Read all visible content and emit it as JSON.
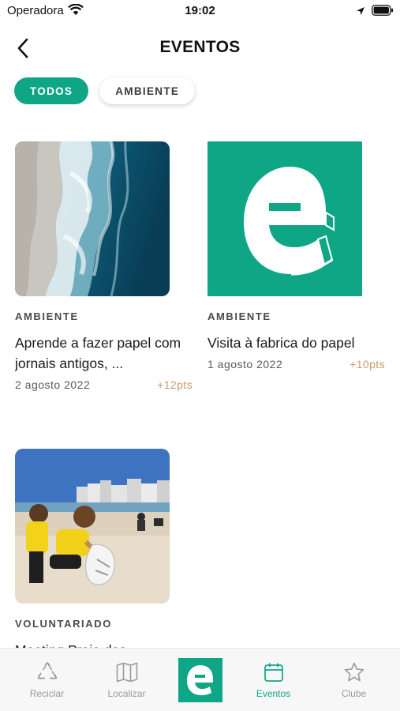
{
  "status_bar": {
    "carrier": "Operadora",
    "time": "19:02"
  },
  "nav": {
    "title": "EVENTOS"
  },
  "filters": [
    {
      "label": "TODOS",
      "active": true
    },
    {
      "label": "AMBIENTE",
      "active": false
    }
  ],
  "events": [
    {
      "category": "AMBIENTE",
      "title": "Aprende a fazer papel com jornais antigos, ...",
      "date": "2 agosto 2022",
      "points": "+12pts",
      "image": "ocean-waves-photo"
    },
    {
      "category": "AMBIENTE",
      "title": "Visita à fabrica do papel",
      "date": "1 agosto 2022",
      "points": "+10pts",
      "image": "brand-logo-e"
    },
    {
      "category": "VOLUNTARIADO",
      "title": "Meeting Praia dos ...",
      "image": "beach-cleanup-photo"
    }
  ],
  "tab_bar": {
    "items": [
      {
        "label": "Reciclar",
        "icon": "recycle-icon",
        "active": false
      },
      {
        "label": "Localizar",
        "icon": "map-icon",
        "active": false
      },
      {
        "label": "Eventos",
        "icon": "calendar-icon",
        "active": true
      },
      {
        "label": "Clube",
        "icon": "star-icon",
        "active": false
      }
    ],
    "center_icon": "brand-e-icon"
  },
  "colors": {
    "accent": "#0fa685",
    "points": "#c79a6b",
    "tab_inactive": "#9a9a9a"
  }
}
